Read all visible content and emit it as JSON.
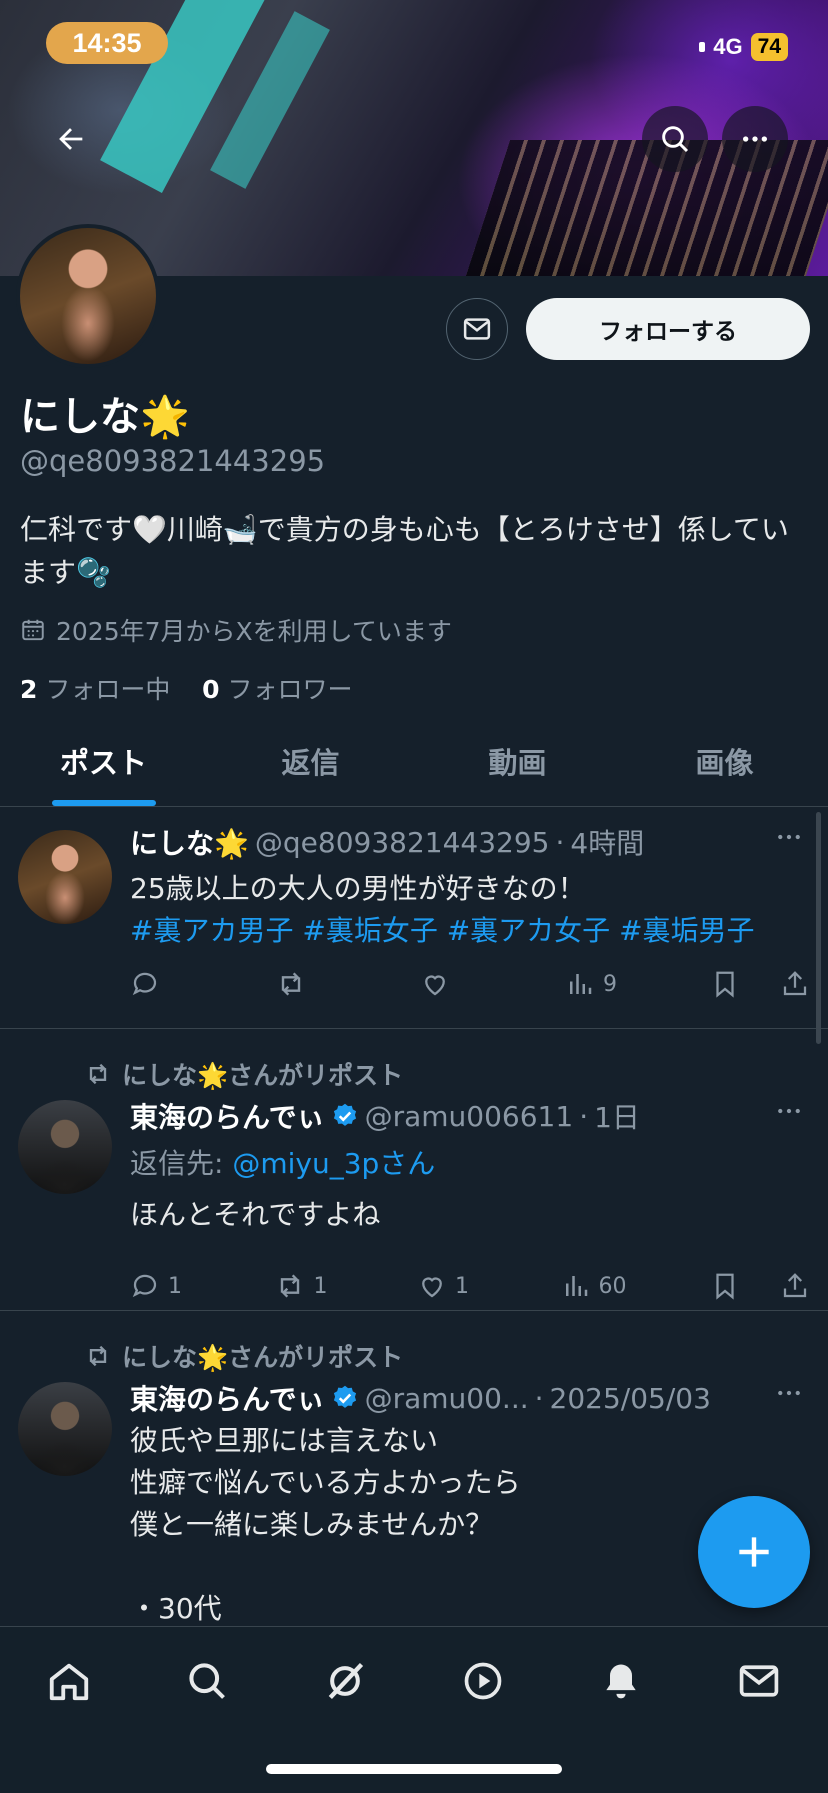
{
  "status_bar": {
    "time": "14:35",
    "network": "4G",
    "battery": "74"
  },
  "profile": {
    "name": "にしな🌟",
    "handle": "@qe8093821443295",
    "bio": "仁科です🤍川崎🛁で貴方の身も心も【とろけさせ】係しています🫧",
    "joined": "2025年7月からXを利用しています",
    "following_count": "2",
    "following_label": "フォロー中",
    "followers_count": "0",
    "followers_label": "フォロワー",
    "follow_button": "フォローする"
  },
  "tabs": [
    "ポスト",
    "返信",
    "動画",
    "画像"
  ],
  "posts": [
    {
      "name": "にしな🌟",
      "handle": "@qe8093821443295",
      "time": "4時間",
      "text": "25歳以上の大人の男性が好きなの！",
      "hashtags": "#裏アカ男子 #裏垢女子 #裏アカ女子 #裏垢男子",
      "views": "9"
    },
    {
      "repost_label": "にしな🌟さんがリポスト",
      "name": "東海のらんでぃ",
      "handle": "@ramu006611",
      "time": "1日",
      "reply_prefix": "返信先: ",
      "reply_to": "@miyu_3pさん",
      "text": "ほんとそれですよね",
      "replies": "1",
      "reposts": "1",
      "likes": "1",
      "views": "60"
    },
    {
      "repost_label": "にしな🌟さんがリポスト",
      "name": "東海のらんでぃ",
      "handle": "@ramu00...",
      "time": "2025/05/03",
      "line1": "彼氏や旦那には言えない",
      "line2": "性癖で悩んでいる方よかったら",
      "line3": "僕と一緒に楽しみませんか？",
      "line4": "・30代"
    }
  ],
  "colors": {
    "accent": "#1d9bf0",
    "background": "#15202b",
    "muted": "#8b98a5"
  },
  "icons": [
    "back-arrow-icon",
    "search-icon",
    "more-icon",
    "mail-icon",
    "calendar-icon",
    "reply-icon",
    "repost-icon",
    "like-icon",
    "views-icon",
    "bookmark-icon",
    "share-icon",
    "verified-icon",
    "plus-icon",
    "home-icon",
    "grok-icon",
    "video-icon",
    "bell-icon"
  ]
}
